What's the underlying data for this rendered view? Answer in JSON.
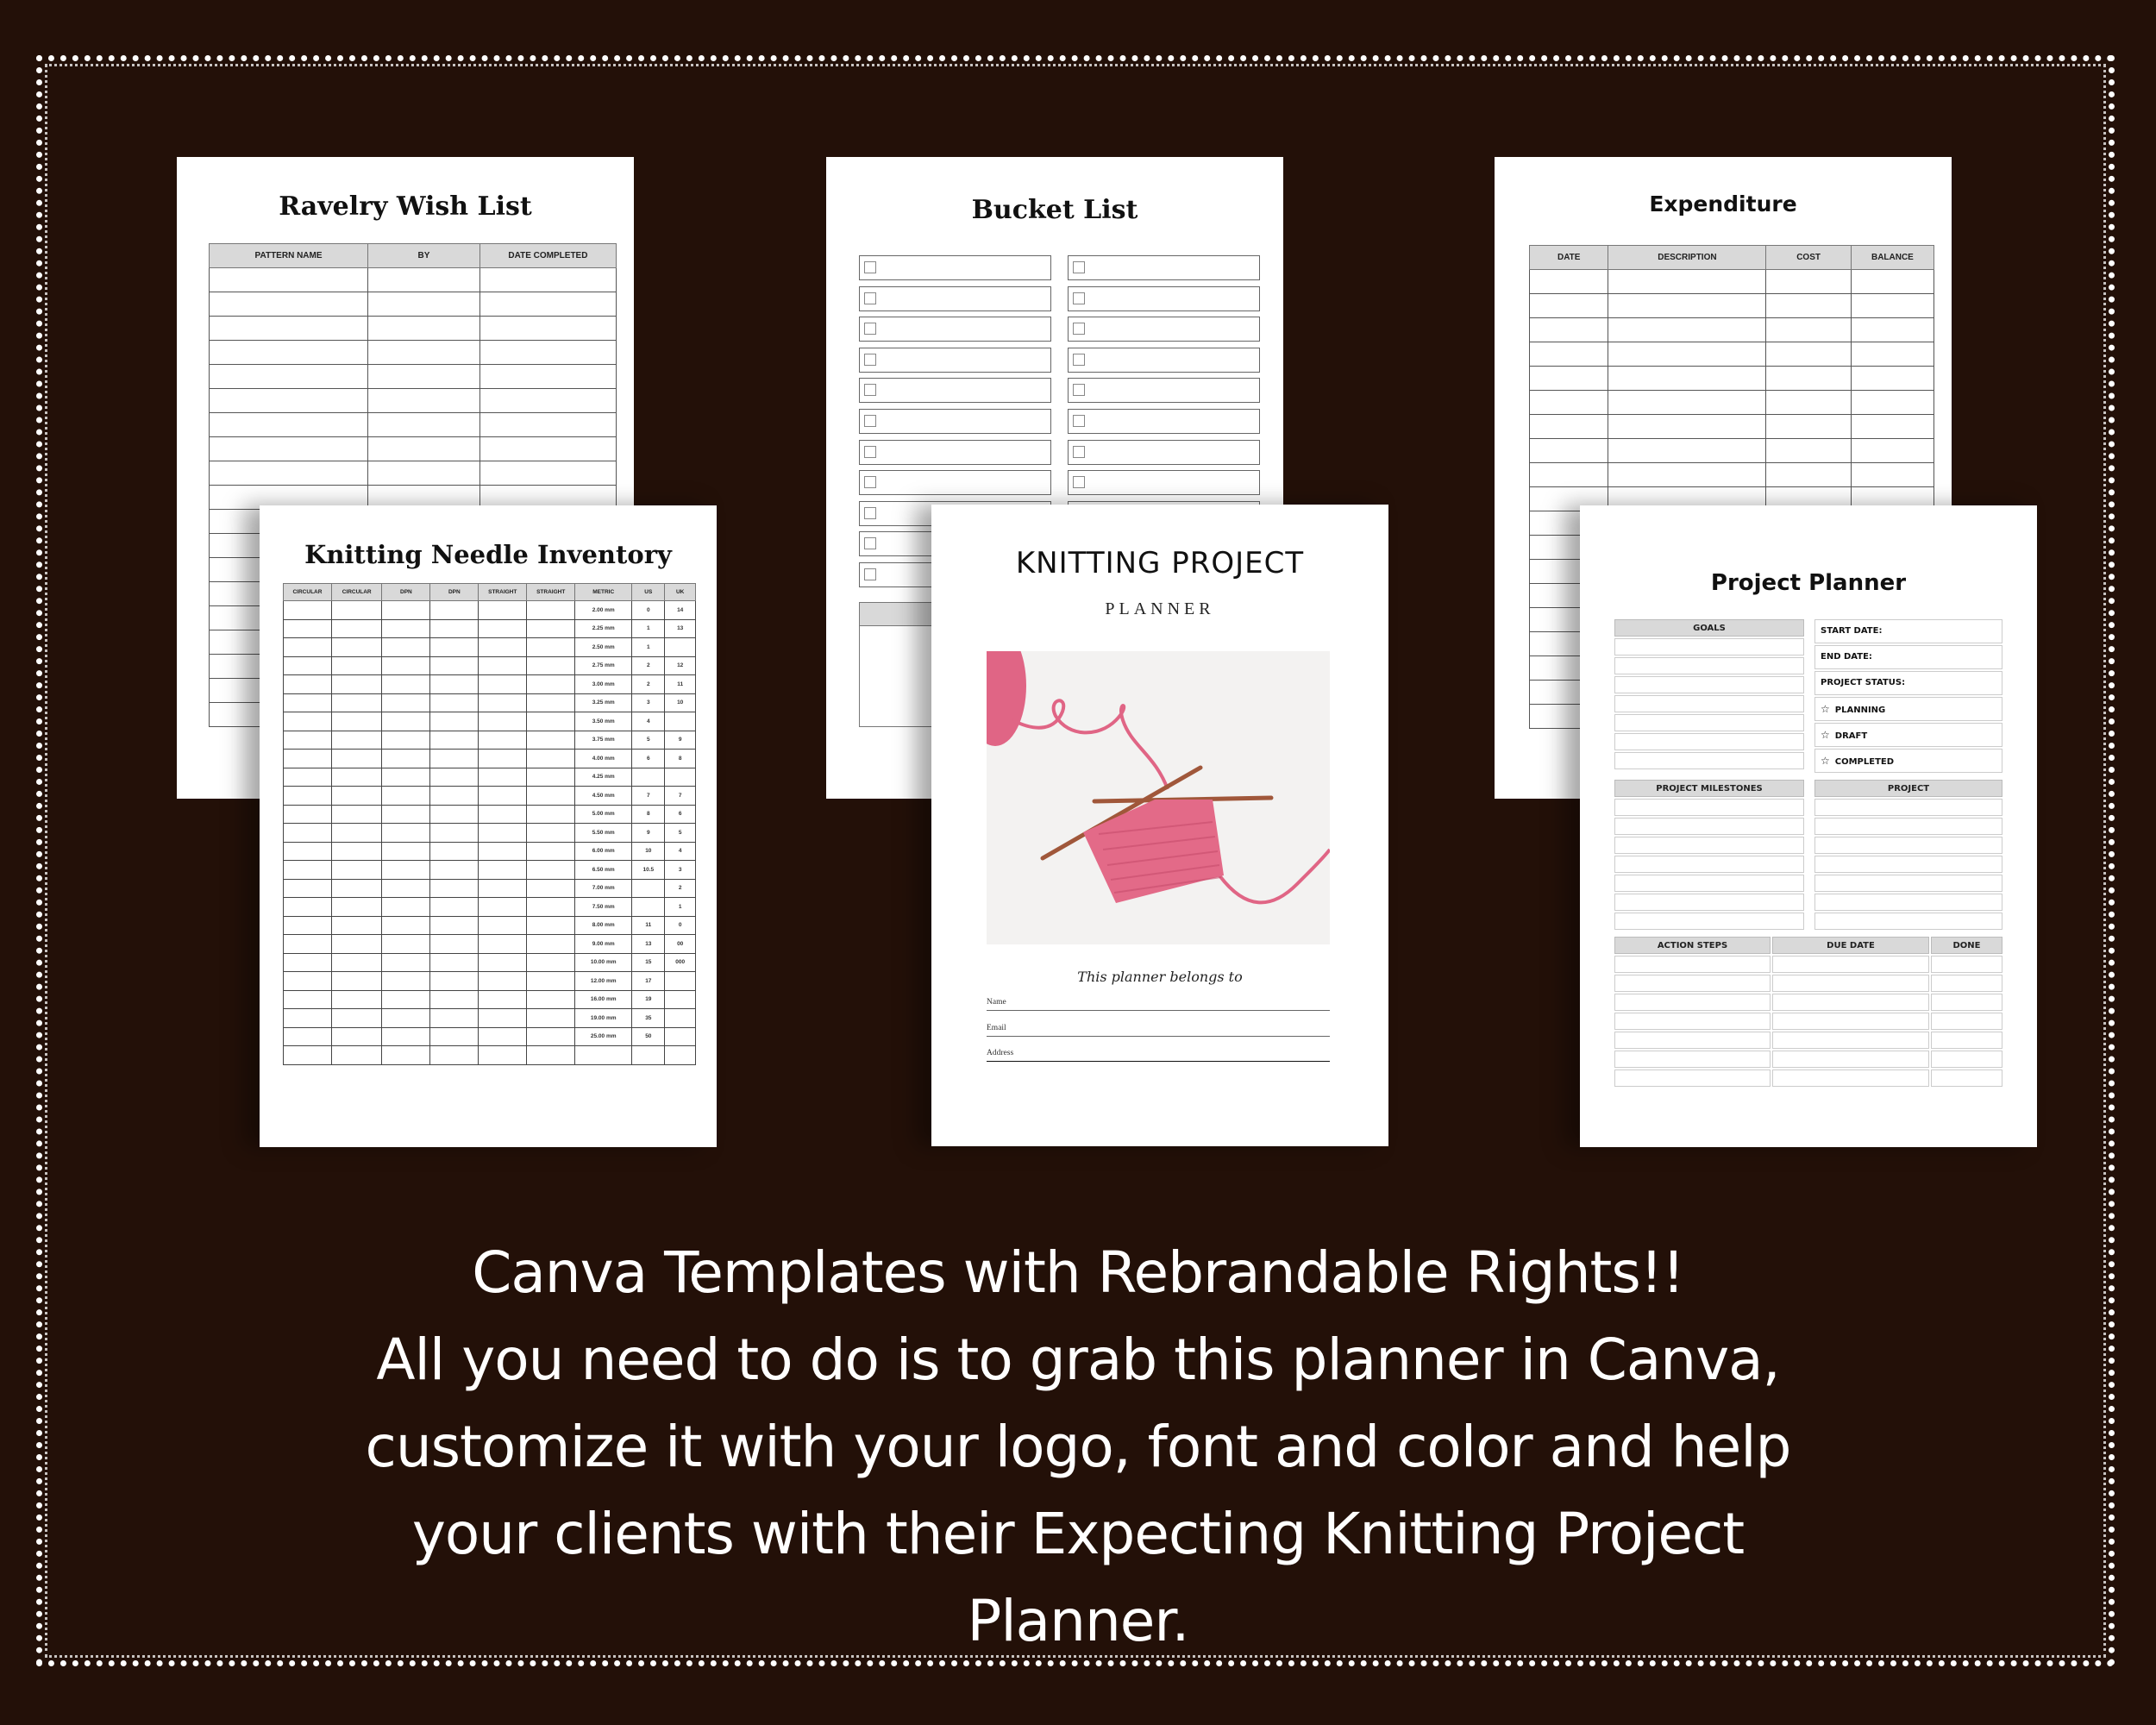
{
  "theme": {
    "background": "#231008",
    "border_dots": "#ffffff",
    "header_fill": "#d9d9d9",
    "yarn_pink": "#e06585",
    "needle_wood": "#a0573a"
  },
  "ravelry": {
    "title": "Ravelry Wish List",
    "headers": [
      "PATTERN NAME",
      "BY",
      "DATE COMPLETED"
    ],
    "rows": 19
  },
  "bucket": {
    "title": "Bucket List",
    "rows_per_column": 11,
    "columns": 2
  },
  "expenditure": {
    "title": "Expenditure",
    "headers": [
      "DATE",
      "DESCRIPTION",
      "COST",
      "BALANCE"
    ],
    "rows": 19
  },
  "inventory": {
    "title": "Knitting Needle Inventory",
    "headers": [
      "CIRCULAR",
      "CIRCULAR",
      "DPN",
      "DPN",
      "STRAIGHT",
      "STRAIGHT",
      "METRIC",
      "US",
      "UK"
    ],
    "sizes": [
      {
        "metric": "2.00 mm",
        "us": "0",
        "uk": "14"
      },
      {
        "metric": "2.25 mm",
        "us": "1",
        "uk": "13"
      },
      {
        "metric": "2.50 mm",
        "us": "1",
        "uk": ""
      },
      {
        "metric": "2.75 mm",
        "us": "2",
        "uk": "12"
      },
      {
        "metric": "3.00 mm",
        "us": "2",
        "uk": "11"
      },
      {
        "metric": "3.25 mm",
        "us": "3",
        "uk": "10"
      },
      {
        "metric": "3.50 mm",
        "us": "4",
        "uk": ""
      },
      {
        "metric": "3.75 mm",
        "us": "5",
        "uk": "9"
      },
      {
        "metric": "4.00 mm",
        "us": "6",
        "uk": "8"
      },
      {
        "metric": "4.25 mm",
        "us": "",
        "uk": ""
      },
      {
        "metric": "4.50 mm",
        "us": "7",
        "uk": "7"
      },
      {
        "metric": "5.00 mm",
        "us": "8",
        "uk": "6"
      },
      {
        "metric": "5.50 mm",
        "us": "9",
        "uk": "5"
      },
      {
        "metric": "6.00 mm",
        "us": "10",
        "uk": "4"
      },
      {
        "metric": "6.50 mm",
        "us": "10.5",
        "uk": "3"
      },
      {
        "metric": "7.00 mm",
        "us": "",
        "uk": "2"
      },
      {
        "metric": "7.50 mm",
        "us": "",
        "uk": "1"
      },
      {
        "metric": "8.00 mm",
        "us": "11",
        "uk": "0"
      },
      {
        "metric": "9.00 mm",
        "us": "13",
        "uk": "00"
      },
      {
        "metric": "10.00 mm",
        "us": "15",
        "uk": "000"
      },
      {
        "metric": "12.00 mm",
        "us": "17",
        "uk": ""
      },
      {
        "metric": "16.00 mm",
        "us": "19",
        "uk": ""
      },
      {
        "metric": "19.00 mm",
        "us": "35",
        "uk": ""
      },
      {
        "metric": "25.00 mm",
        "us": "50",
        "uk": ""
      },
      {
        "metric": "",
        "us": "",
        "uk": ""
      }
    ]
  },
  "cover": {
    "title": "KNITTING PROJECT",
    "subtitle": "PLANNER",
    "photo_icon": "knitting-swatch-on-needles",
    "belongs": "This planner belongs to",
    "fields": [
      "Name",
      "Email",
      "Address"
    ]
  },
  "planner": {
    "title": "Project Planner",
    "goals_header": "GOALS",
    "goals_rows": 7,
    "info": [
      "START DATE:",
      "END DATE:",
      "PROJECT STATUS:"
    ],
    "statuses": [
      "PLANNING",
      "DRAFT",
      "COMPLETED"
    ],
    "milestones_header": "PROJECT MILESTONES",
    "project_header": "PROJECT",
    "milestone_rows": 7,
    "action_headers": [
      "ACTION STEPS",
      "DUE DATE",
      "DONE"
    ],
    "action_rows": 7
  },
  "promo": {
    "lines": [
      "Canva Templates with Rebrandable Rights!!",
      "All you need to do is to grab this planner in Canva,",
      "customize it with your logo, font and color and help",
      "your clients with their Expecting Knitting Project",
      "Planner."
    ]
  }
}
